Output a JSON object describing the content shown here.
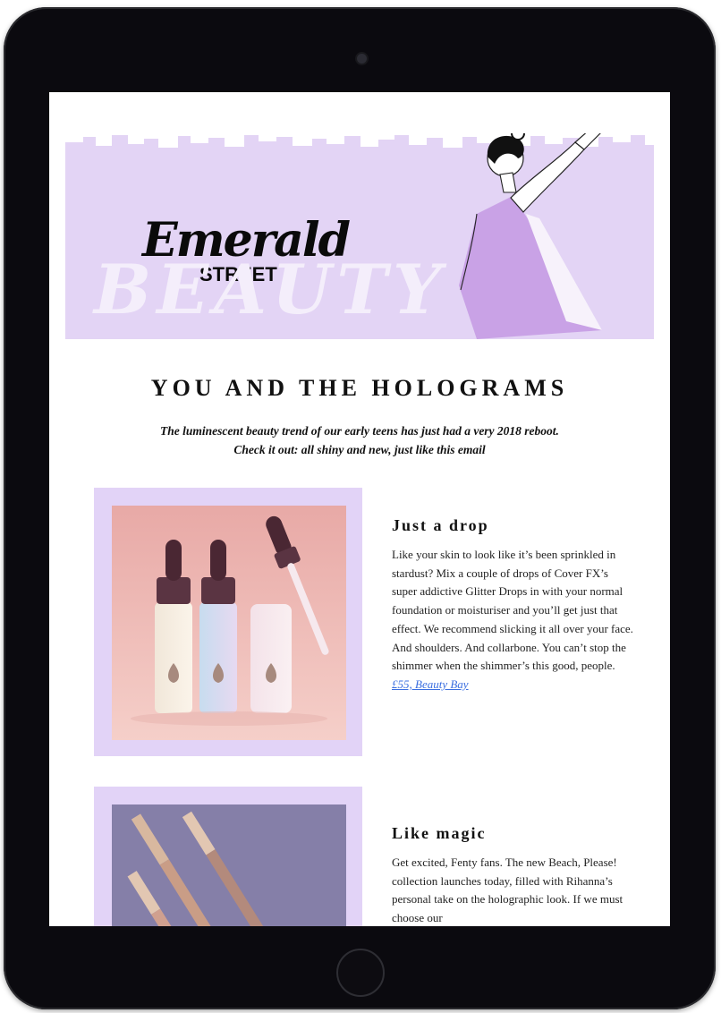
{
  "brand": {
    "logo_main": "Emerald",
    "logo_sub": "STREET",
    "section": "BEAUTY"
  },
  "headline": "YOU AND THE HOLOGRAMS",
  "subhead_line1": "The luminescent beauty trend of our early teens has just had a very 2018 reboot.",
  "subhead_line2": "Check it out: all shiny and new, just like this email",
  "articles": [
    {
      "title": "Just a drop",
      "body": "Like your skin to look like it’s been sprinkled in stardust? Mix a couple of drops of Cover FX’s super addictive Glitter Drops in with your normal foundation or moisturiser and you’ll get just that effect. We recommend slicking it all over your face. And shoulders. And collarbone. You can’t stop the shimmer when the shimmer’s this good, people.",
      "link": "£55, Beauty Bay"
    },
    {
      "title": "Like magic",
      "body": "Get excited, Fenty fans. The new Beach, Please! collection launches today, filled with Rihanna’s personal take on the holographic look. If we must choose our"
    }
  ],
  "colors": {
    "lilac": "#e3d4f5",
    "device": "#0b0a0f",
    "link": "#3b6fe0"
  }
}
